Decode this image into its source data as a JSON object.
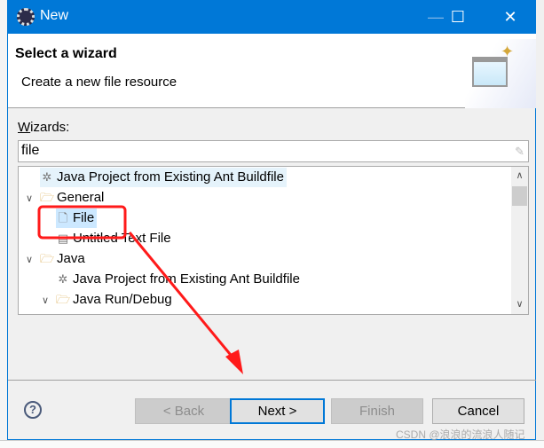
{
  "window": {
    "title": "New",
    "minimize_icon": "minimize-icon",
    "maximize_icon": "maximize-icon",
    "close_icon": "close-icon",
    "accent": "#0078d7"
  },
  "header": {
    "title": "Select a wizard",
    "description": "Create a new file resource"
  },
  "wizards": {
    "label_underlined": "W",
    "label_rest": "izards:",
    "filter_value": "file"
  },
  "tree": [
    {
      "label": "Java Project from Existing Ant Buildfile",
      "icon": "ant-icon",
      "state": "highlighted"
    },
    {
      "label": "General",
      "icon": "folder-icon",
      "expanded": true
    },
    {
      "label": "File",
      "icon": "new-file-icon",
      "state": "selected"
    },
    {
      "label": "Untitled Text File",
      "icon": "text-file-icon"
    },
    {
      "label": "Java",
      "icon": "folder-icon",
      "expanded": true
    },
    {
      "label": "Java Project from Existing Ant Buildfile",
      "icon": "ant-icon"
    },
    {
      "label": "Java Run/Debug",
      "icon": "folder-icon",
      "expanded": true
    }
  ],
  "buttons": {
    "back": "< Back",
    "next": "Next >",
    "finish": "Finish",
    "cancel": "Cancel"
  },
  "watermark": "CSDN @浪浪的流浪人随记",
  "annotation_color": "#ff1a1a"
}
